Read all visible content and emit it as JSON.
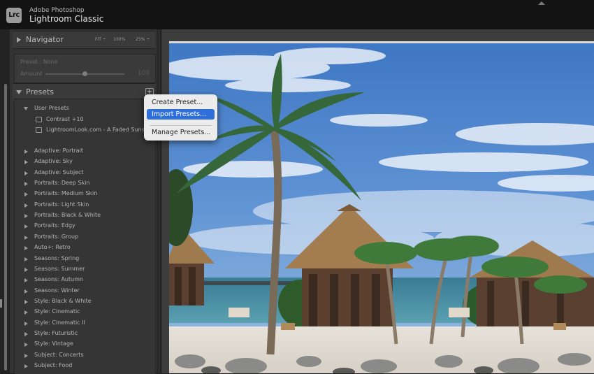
{
  "app": {
    "vendor": "Adobe Photoshop",
    "name": "Lightroom Classic",
    "logo_text": "Lrc"
  },
  "navigator": {
    "title": "Navigator",
    "zoom_options": [
      "FIT ÷",
      "100%",
      "25% ÷"
    ]
  },
  "preset_panel": {
    "preset_line": "Preset : None",
    "amount_label": "Amount",
    "amount_value": "100",
    "amount_fraction": 0.5
  },
  "presets": {
    "title": "Presets",
    "add_icon": "plus-icon",
    "user_group": {
      "label": "User Presets",
      "items": [
        "Contrast +10",
        "LightroomLook.com - A Faded Sunset"
      ]
    },
    "groups": [
      "Adaptive: Portrait",
      "Adaptive: Sky",
      "Adaptive: Subject",
      "Portraits: Deep Skin",
      "Portraits: Medium Skin",
      "Portraits: Light Skin",
      "Portraits: Black & White",
      "Portraits: Edgy",
      "Portraits: Group",
      "Auto+: Retro",
      "Seasons: Spring",
      "Seasons: Summer",
      "Seasons: Autumn",
      "Seasons: Winter",
      "Style: Black & White",
      "Style: Cinematic",
      "Style: Cinematic II",
      "Style: Futuristic",
      "Style: Vintage",
      "Subject: Concerts",
      "Subject: Food"
    ]
  },
  "context_menu": {
    "items": [
      {
        "label": "Create Preset...",
        "highlighted": false
      },
      {
        "label": "Import Presets...",
        "highlighted": true
      },
      {
        "label": "Manage Presets...",
        "highlighted": false
      }
    ]
  },
  "colors": {
    "accent": "#2f6fd9",
    "panel": "#333333",
    "titlebar": "#131313"
  }
}
